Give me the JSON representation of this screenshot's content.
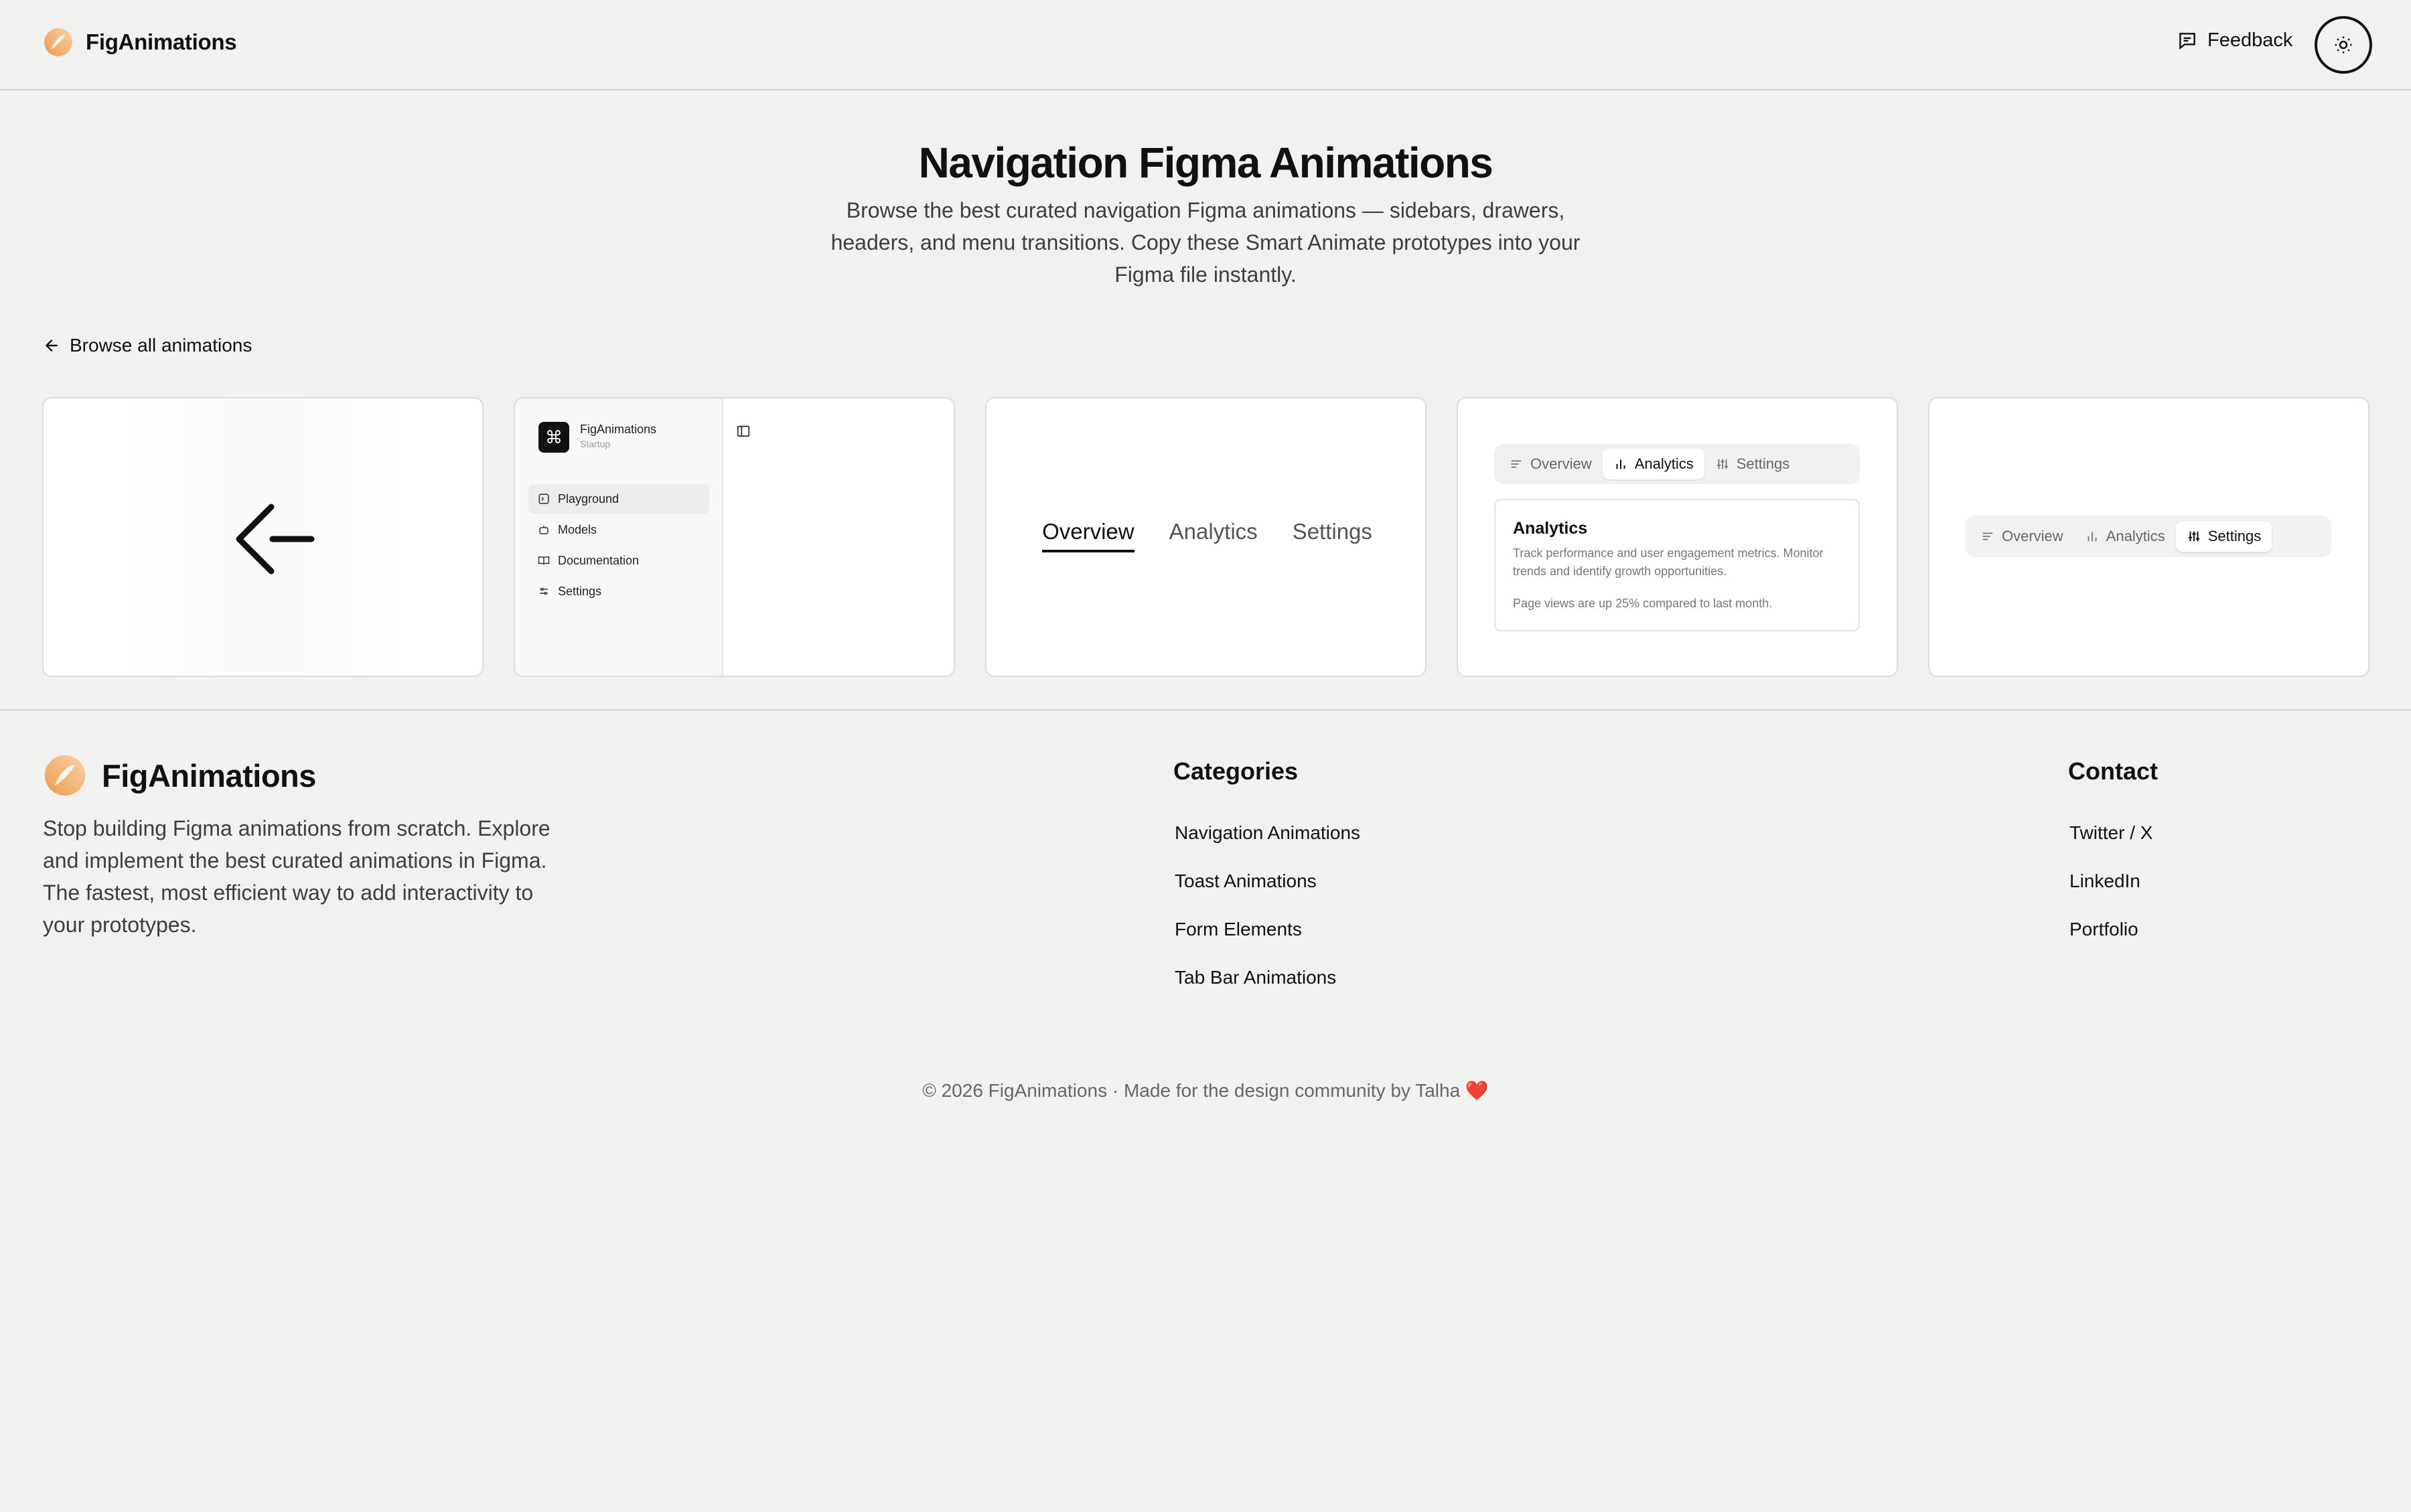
{
  "header": {
    "brand": "FigAnimations",
    "feedback_label": "Feedback"
  },
  "hero": {
    "title": "Navigation Figma Animations",
    "description": "Browse the best curated navigation Figma animations — sidebars, drawers, headers, and menu transitions. Copy these Smart Animate prototypes into your Figma file instantly."
  },
  "back_link": "Browse all animations",
  "cards": {
    "sidebar": {
      "app_name": "FigAnimations",
      "app_sub": "Startup",
      "items": [
        "Playground",
        "Models",
        "Documentation",
        "Settings"
      ]
    },
    "tabs_underline": [
      "Overview",
      "Analytics",
      "Settings"
    ],
    "tabs_panel": {
      "tabs": [
        "Overview",
        "Analytics",
        "Settings"
      ],
      "heading": "Analytics",
      "body": "Track performance and user engagement metrics. Monitor trends and identify growth opportunities.",
      "note": "Page views are up 25% compared to last month."
    },
    "segmented": [
      "Overview",
      "Analytics",
      "Settings"
    ]
  },
  "footer": {
    "brand": "FigAnimations",
    "description": "Stop building Figma animations from scratch. Explore and implement the best curated animations in Figma. The fastest, most efficient way to add interactivity to your prototypes.",
    "categories_heading": "Categories",
    "categories": [
      "Navigation Animations",
      "Toast Animations",
      "Form Elements",
      "Tab Bar Animations"
    ],
    "contact_heading": "Contact",
    "contact": [
      "Twitter / X",
      "LinkedIn",
      "Portfolio"
    ],
    "copyright": "© 2026 FigAnimations · Made for the design community by Talha ❤️"
  },
  "colors": {
    "background": "#f1f1ef",
    "accent_orange": "#f0a35e"
  }
}
